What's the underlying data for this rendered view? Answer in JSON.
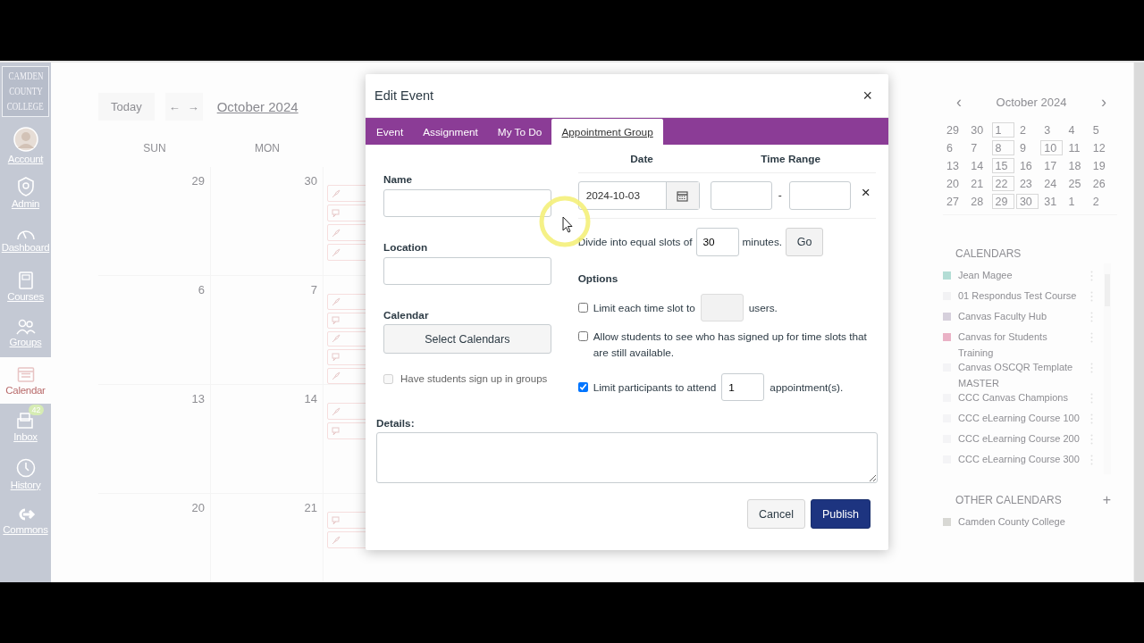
{
  "nav": {
    "logo": [
      "CAMDEN",
      "COUNTY",
      "COLLEGE"
    ],
    "items": [
      {
        "label": "Account",
        "kind": "avatar",
        "selected": false
      },
      {
        "label": "Admin",
        "kind": "shield",
        "selected": false
      },
      {
        "label": "Dashboard",
        "kind": "gauge",
        "selected": false
      },
      {
        "label": "Courses",
        "kind": "book",
        "selected": false
      },
      {
        "label": "Groups",
        "kind": "people",
        "selected": false
      },
      {
        "label": "Calendar",
        "kind": "calendar",
        "selected": true
      },
      {
        "label": "Inbox",
        "kind": "inbox",
        "selected": false,
        "badge": "42"
      },
      {
        "label": "History",
        "kind": "clock",
        "selected": false
      },
      {
        "label": "Commons",
        "kind": "share",
        "selected": false
      }
    ]
  },
  "calendar": {
    "today": "Today",
    "prev": "←",
    "next": "→",
    "month": "October 2024",
    "weekdays": [
      "SUN",
      "MON"
    ],
    "weeks": [
      {
        "days": [
          "29",
          "30"
        ],
        "events": [
          {
            "kind": "assignment"
          },
          {
            "kind": "discussion"
          },
          {
            "kind": "assignment"
          },
          {
            "kind": "assignment"
          }
        ]
      },
      {
        "days": [
          "6",
          "7"
        ],
        "events": [
          {
            "kind": "assignment"
          },
          {
            "kind": "discussion"
          },
          {
            "kind": "assignment"
          },
          {
            "kind": "discussion"
          },
          {
            "kind": "assignment"
          }
        ]
      },
      {
        "days": [
          "13",
          "14"
        ],
        "events": [
          {
            "kind": "assignment"
          },
          {
            "kind": "discussion"
          }
        ]
      },
      {
        "days": [
          "20",
          "21"
        ],
        "events": [
          {
            "kind": "discussion"
          },
          {
            "kind": "assignment"
          }
        ]
      }
    ]
  },
  "dialog": {
    "title": "Edit Event",
    "close": "×",
    "tabs": [
      {
        "label": "Event",
        "selected": false
      },
      {
        "label": "Assignment",
        "selected": false
      },
      {
        "label": "My To Do",
        "selected": false
      },
      {
        "label": "Appointment Group",
        "selected": true
      }
    ],
    "name_label": "Name",
    "location_label": "Location",
    "calendar_label": "Calendar",
    "select_calendars": "Select Calendars",
    "groups_checkbox": {
      "label": "Have students sign up in groups",
      "checked": false,
      "disabled": true
    },
    "date_header": "Date",
    "time_header": "Time Range",
    "date_value": "2024-10-03",
    "time_separator": "-",
    "remove": "×",
    "divide_text": "Divide into equal slots of",
    "slot_minutes": "30",
    "minutes_text": "minutes.",
    "go": "Go",
    "options_label": "Options",
    "options": [
      {
        "kind": "field",
        "label": "Limit each time slot to",
        "checked": false,
        "value_disabled": true,
        "suffix": "users."
      },
      {
        "kind": "plain",
        "label": "Allow students to see who has signed up for time slots that are still available.",
        "checked": false
      },
      {
        "kind": "field",
        "label": "Limit participants to attend",
        "checked": true,
        "value": "1",
        "value_disabled": false,
        "suffix": "appointment(s)."
      }
    ],
    "details_label": "Details:",
    "cancel": "Cancel",
    "publish": "Publish"
  },
  "sidebar": {
    "prev": "‹",
    "next": "›",
    "month": "October 2024",
    "weeks": [
      [
        {
          "d": "29",
          "marked": false
        },
        {
          "d": "30",
          "marked": false
        },
        {
          "d": "1",
          "marked": true
        },
        {
          "d": "2",
          "marked": false
        },
        {
          "d": "3",
          "marked": false
        },
        {
          "d": "4",
          "marked": false
        },
        {
          "d": "5",
          "marked": false
        }
      ],
      [
        {
          "d": "6",
          "marked": false
        },
        {
          "d": "7",
          "marked": false
        },
        {
          "d": "8",
          "marked": true
        },
        {
          "d": "9",
          "marked": false
        },
        {
          "d": "10",
          "marked": true
        },
        {
          "d": "11",
          "marked": false
        },
        {
          "d": "12",
          "marked": false
        }
      ],
      [
        {
          "d": "13",
          "marked": false
        },
        {
          "d": "14",
          "marked": false
        },
        {
          "d": "15",
          "marked": true
        },
        {
          "d": "16",
          "marked": false
        },
        {
          "d": "17",
          "marked": false
        },
        {
          "d": "18",
          "marked": false
        },
        {
          "d": "19",
          "marked": false
        }
      ],
      [
        {
          "d": "20",
          "marked": false
        },
        {
          "d": "21",
          "marked": false
        },
        {
          "d": "22",
          "marked": true
        },
        {
          "d": "23",
          "marked": false
        },
        {
          "d": "24",
          "marked": false
        },
        {
          "d": "25",
          "marked": false
        },
        {
          "d": "26",
          "marked": false
        }
      ],
      [
        {
          "d": "27",
          "marked": false
        },
        {
          "d": "28",
          "marked": false
        },
        {
          "d": "29",
          "marked": true
        },
        {
          "d": "30",
          "marked": true
        },
        {
          "d": "31",
          "marked": false
        },
        {
          "d": "1",
          "marked": false
        },
        {
          "d": "2",
          "marked": false
        }
      ]
    ],
    "calendars_title": "CALENDARS",
    "calendars": [
      {
        "name": "Jean Magee",
        "color": "#b3ddd5"
      },
      {
        "name": "01 Respondus Test Course",
        "color": "#f2f2f4"
      },
      {
        "name": "Canvas Faculty Hub",
        "color": "#d6d0dc"
      },
      {
        "name": "Canvas for Students Training",
        "color": "#eab2c6"
      },
      {
        "name": "Canvas OSCQR Template MASTER",
        "color": "#f4f4f6"
      },
      {
        "name": "CCC Canvas Champions",
        "color": "#f4f4f6"
      },
      {
        "name": "CCC eLearning Course 100",
        "color": "#f4f4f6"
      },
      {
        "name": "CCC eLearning Course 200",
        "color": "#f4f4f6"
      },
      {
        "name": "CCC eLearning Course 300",
        "color": "#f4f4f6"
      }
    ],
    "other_title": "OTHER CALENDARS",
    "add": "+",
    "other": [
      {
        "name": "Camden County College",
        "color": "#d8d8d4"
      }
    ]
  }
}
